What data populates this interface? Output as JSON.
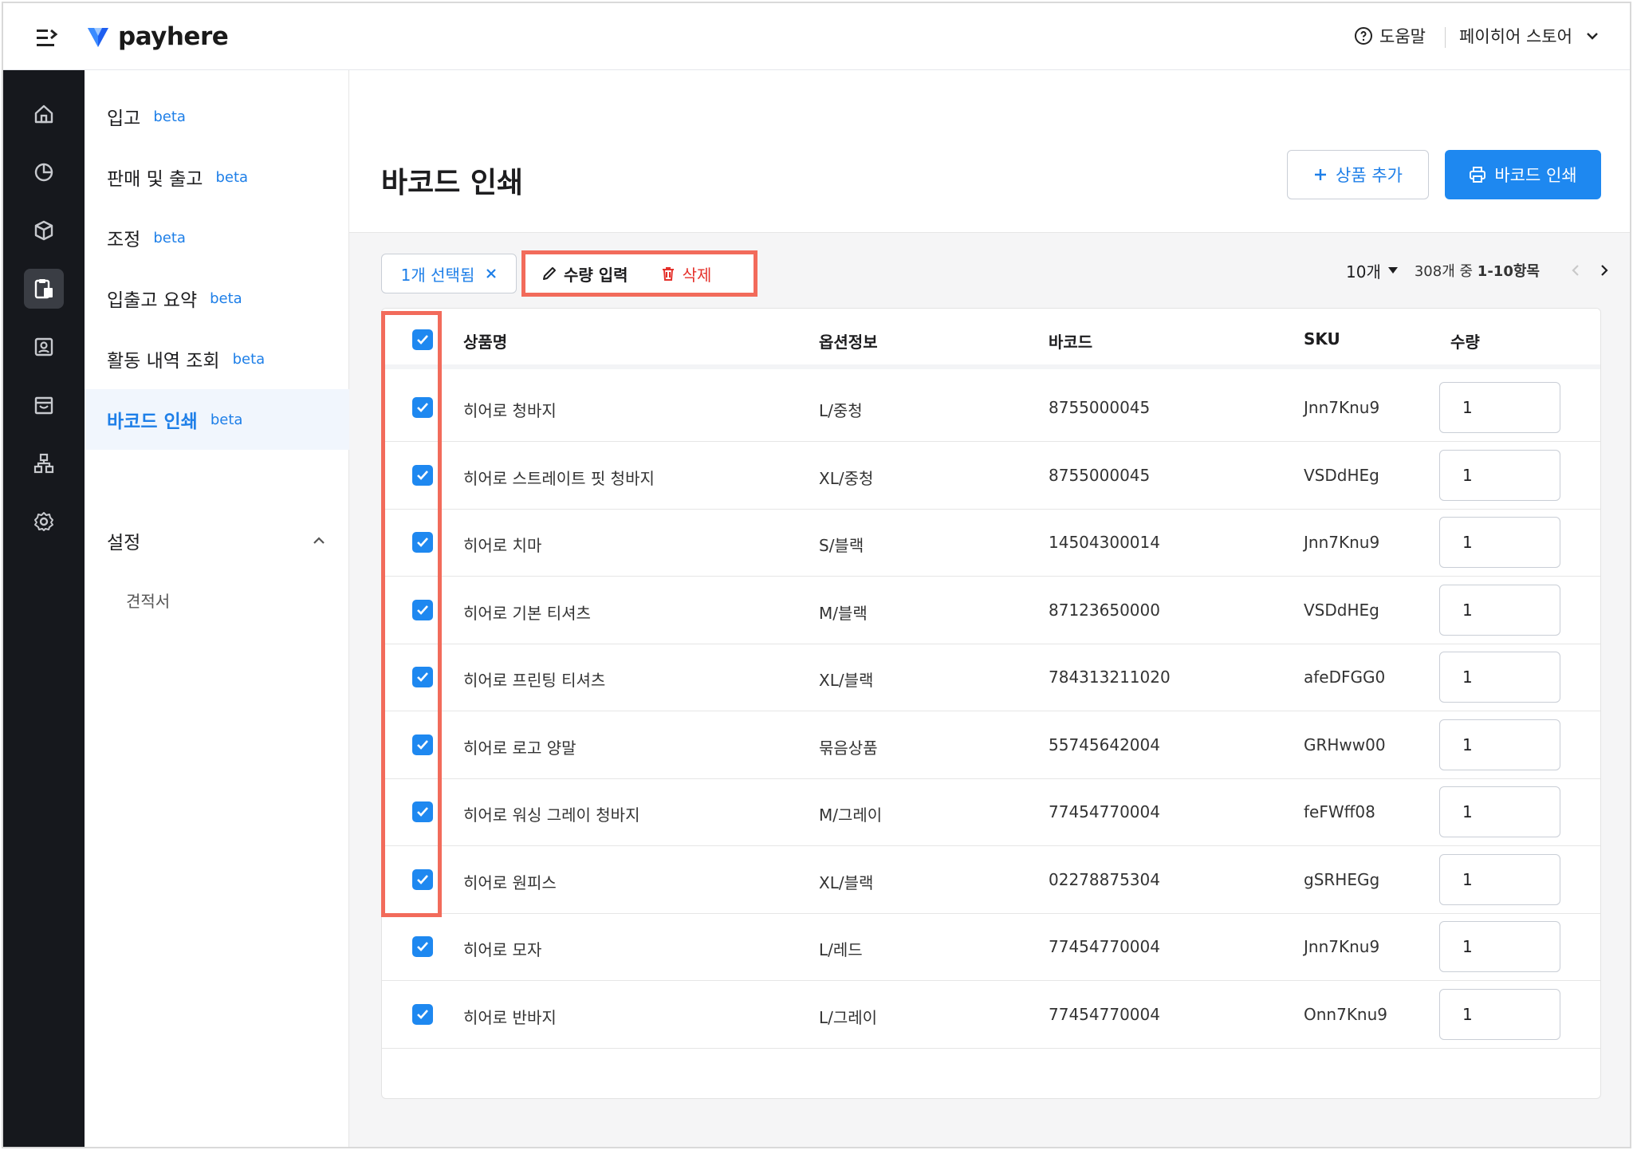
{
  "header": {
    "brand": "payhere",
    "help_label": "도움말",
    "store_name": "페이히어 스토어"
  },
  "rail": {
    "icons": [
      "home-icon",
      "pie-chart-icon",
      "box-icon",
      "clipboard-icon",
      "contact-card-icon",
      "store-icon",
      "org-chart-icon",
      "gear-icon"
    ],
    "active_index": 3
  },
  "subnav": {
    "items": [
      {
        "label": "입고",
        "badge": "beta"
      },
      {
        "label": "판매 및 출고",
        "badge": "beta"
      },
      {
        "label": "조정",
        "badge": "beta"
      },
      {
        "label": "입출고 요약",
        "badge": "beta"
      },
      {
        "label": "활동 내역 조회",
        "badge": "beta"
      },
      {
        "label": "바코드 인쇄",
        "badge": "beta"
      }
    ],
    "settings_label": "설정",
    "settings_children": [
      "견적서"
    ]
  },
  "page": {
    "title": "바코드 인쇄",
    "add_button": "상품 추가",
    "print_button": "바코드 인쇄"
  },
  "toolbar": {
    "selected_label": "1개 선택됨",
    "qty_action": "수량 입력",
    "delete_action": "삭제",
    "per_page": "10개",
    "range_prefix": "308개 중",
    "range_value": "1-10항목"
  },
  "table": {
    "columns": [
      "상품명",
      "옵션정보",
      "바코드",
      "SKU",
      "수량"
    ],
    "rows": [
      {
        "name": "히어로 청바지",
        "option": "L/중청",
        "barcode": "8755000045",
        "sku": "Jnn7Knu9",
        "qty": "1"
      },
      {
        "name": "히어로 스트레이트 핏 청바지",
        "option": "XL/중청",
        "barcode": "8755000045",
        "sku": "VSDdHEg",
        "qty": "1"
      },
      {
        "name": "히어로 치마",
        "option": "S/블랙",
        "barcode": "14504300014",
        "sku": "Jnn7Knu9",
        "qty": "1"
      },
      {
        "name": "히어로 기본 티셔츠",
        "option": "M/블랙",
        "barcode": "87123650000",
        "sku": "VSDdHEg",
        "qty": "1"
      },
      {
        "name": "히어로 프린팅 티셔츠",
        "option": "XL/블랙",
        "barcode": "784313211020",
        "sku": "afeDFGG0",
        "qty": "1"
      },
      {
        "name": "히어로 로고 양말",
        "option": "묶음상품",
        "barcode": "55745642004",
        "sku": "GRHww00",
        "qty": "1"
      },
      {
        "name": "히어로 워싱 그레이 청바지",
        "option": "M/그레이",
        "barcode": "77454770004",
        "sku": "feFWff08",
        "qty": "1"
      },
      {
        "name": "히어로 원피스",
        "option": "XL/블랙",
        "barcode": "02278875304",
        "sku": "gSRHEGg",
        "qty": "1"
      },
      {
        "name": "히어로 모자",
        "option": "L/레드",
        "barcode": "77454770004",
        "sku": "Jnn7Knu9",
        "qty": "1"
      },
      {
        "name": "히어로 반바지",
        "option": "L/그레이",
        "barcode": "77454770004",
        "sku": "Onn7Knu9",
        "qty": "1"
      }
    ]
  },
  "colors": {
    "accent": "#1e88f0",
    "highlight": "#f26b5b",
    "danger": "#e5312b",
    "rail_bg": "#16181d"
  }
}
